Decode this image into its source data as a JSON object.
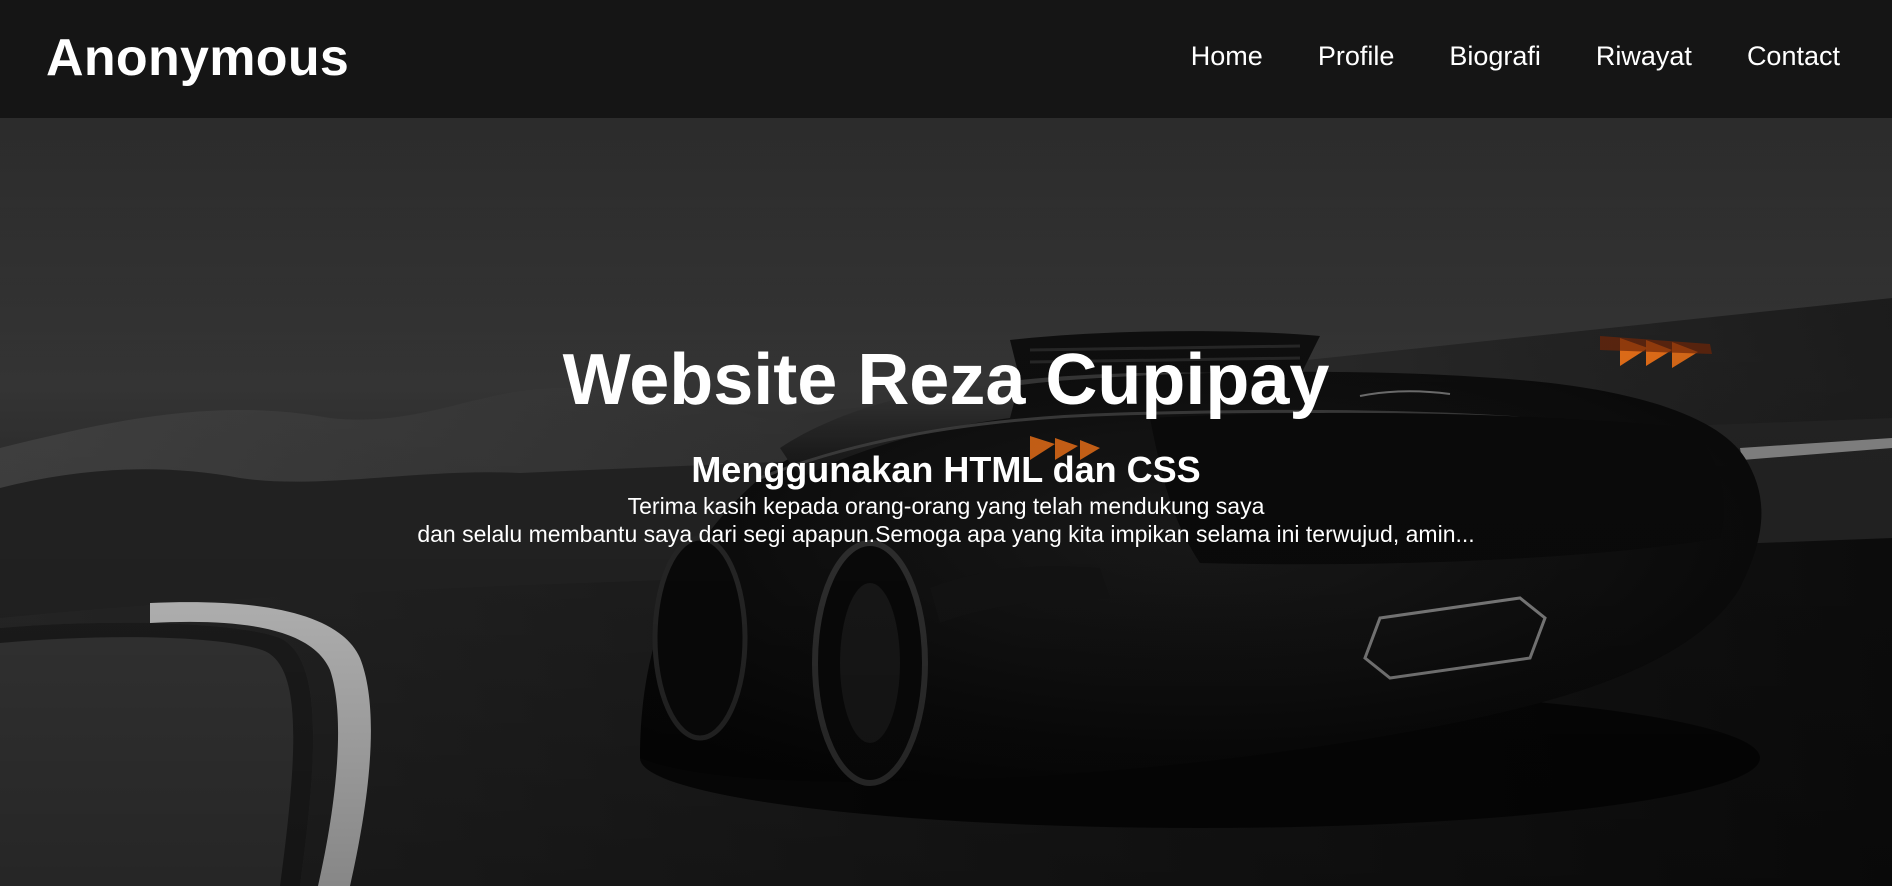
{
  "header": {
    "brand": "Anonymous",
    "nav": [
      "Home",
      "Profile",
      "Biografi",
      "Riwayat",
      "Contact"
    ]
  },
  "hero": {
    "title": "Website Reza Cupipay",
    "subtitle": "Menggunakan HTML dan CSS",
    "text_line1": "Terima kasih kepada orang-orang yang telah mendukung saya",
    "text_line2": "dan selalu membantu saya dari segi apapun.Semoga apa yang kita impikan selama ini terwujud, amin..."
  },
  "colors": {
    "navbar_bg": "#151515",
    "text": "#ffffff",
    "taillight": "#ff7a1a"
  }
}
